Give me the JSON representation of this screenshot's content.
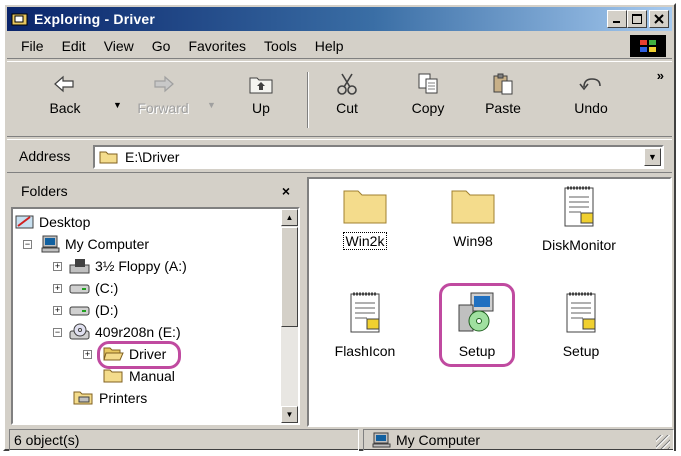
{
  "window": {
    "title": "Exploring - Driver"
  },
  "menu": [
    "File",
    "Edit",
    "View",
    "Go",
    "Favorites",
    "Tools",
    "Help"
  ],
  "toolbar": {
    "back": "Back",
    "forward": "Forward",
    "up": "Up",
    "cut": "Cut",
    "copy": "Copy",
    "paste": "Paste",
    "undo": "Undo",
    "more": "»"
  },
  "address": {
    "label": "Address",
    "value": "E:\\Driver"
  },
  "folders": {
    "header": "Folders",
    "close": "×",
    "tree": [
      {
        "label": "Desktop",
        "icon": "desktop-icon"
      },
      {
        "label": "My Computer",
        "icon": "computer-icon",
        "expander": "−"
      },
      {
        "label": "3½ Floppy (A:)",
        "icon": "floppy-icon",
        "expander": "+"
      },
      {
        "label": "(C:)",
        "icon": "drive-icon",
        "expander": "+"
      },
      {
        "label": "(D:)",
        "icon": "drive-icon",
        "expander": "+"
      },
      {
        "label": "409r208n (E:)",
        "icon": "cd-drive-icon",
        "expander": "−"
      },
      {
        "label": "Driver",
        "icon": "open-folder-icon",
        "expander": "+",
        "highlighted": true
      },
      {
        "label": "Manual",
        "icon": "folder-icon"
      },
      {
        "label": "Printers",
        "icon": "printer-icon"
      }
    ]
  },
  "files": [
    {
      "label": "Win2k",
      "icon": "folder-icon"
    },
    {
      "label": "Win98",
      "icon": "folder-icon"
    },
    {
      "label": "DiskMonitor",
      "icon": "notepad-icon"
    },
    {
      "label": "FlashIcon",
      "icon": "notepad-icon"
    },
    {
      "label": "Setup",
      "icon": "setup-installer-icon",
      "highlighted": true
    },
    {
      "label": "Setup",
      "icon": "notepad-icon"
    }
  ],
  "status": {
    "count": "6 object(s)",
    "location": "My Computer"
  },
  "colors": {
    "highlight_ring": "#c04aa0",
    "titlebar": "#0a246a",
    "folder": "#f4dc8c"
  }
}
